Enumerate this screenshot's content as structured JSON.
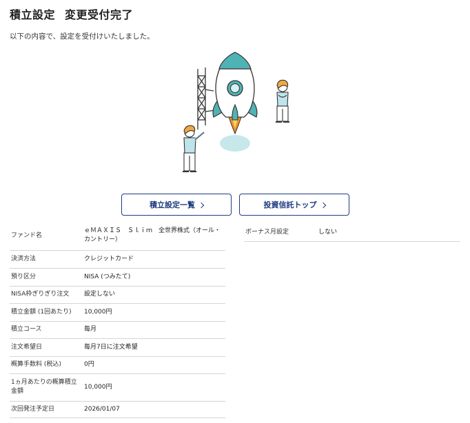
{
  "header": {
    "title_main": "積立設定",
    "title_sub": "変更受付完了"
  },
  "intro_text": "以下の内容で、設定を受付けいたしました。",
  "illustration": {
    "icon": "rocket-launch-illustration",
    "colors": {
      "rocket_body": "#4fb3b6",
      "flame": "#f0912a",
      "shadow": "#c7e8ea",
      "hair": "#f0a840"
    }
  },
  "buttons": {
    "settings_list": "積立設定一覧",
    "fund_top": "投資信託トップ",
    "chevron_icon": "chevron-right-icon",
    "color": "#1d3a7f"
  },
  "details": [
    {
      "label": "ファンド名",
      "value": "ｅＭＡＸＩＳ　Ｓｌｉｍ　全世界株式（オール・カントリー）"
    },
    {
      "label": "決済方法",
      "value": "クレジットカード"
    },
    {
      "label": "預り区分",
      "value": "NISA (つみたて)"
    },
    {
      "label": "NISA枠ぎりぎり注文",
      "value": "設定しない"
    },
    {
      "label": "積立金額 (1回あたり)",
      "value": "10,000円"
    },
    {
      "label": "積立コース",
      "value": "毎月"
    },
    {
      "label": "注文希望日",
      "value": "毎月7日に注文希望"
    },
    {
      "label": "概算手数料 (税込)",
      "value": "0円"
    },
    {
      "label": "1ヵ月あたりの概算積立金額",
      "value": "10,000円"
    },
    {
      "label": "次回発注予定日",
      "value": "2026/01/07"
    }
  ],
  "bonus": {
    "label": "ボーナス月設定",
    "value": "しない"
  }
}
